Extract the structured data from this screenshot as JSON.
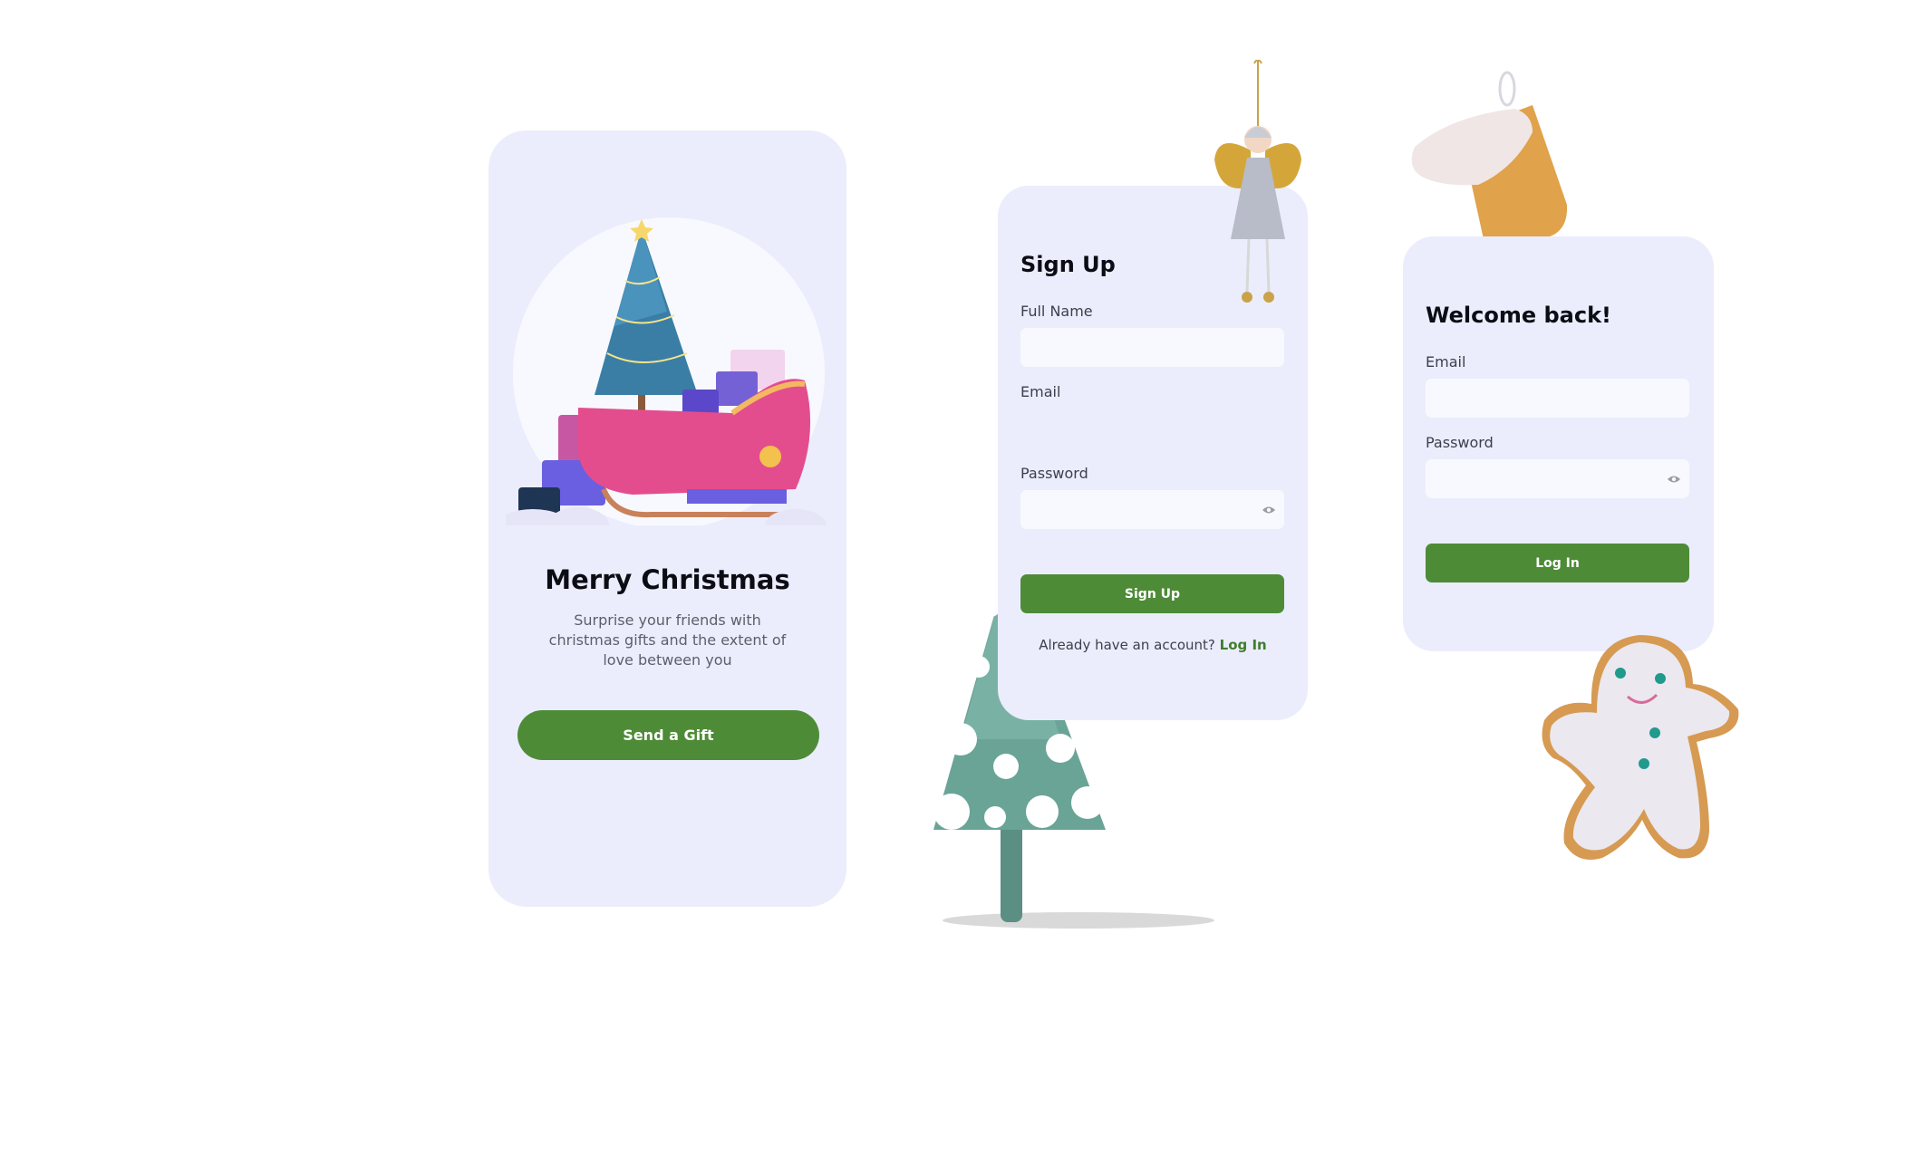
{
  "onboarding": {
    "title": "Merry Christmas",
    "subtitle": "Surprise your friends with christmas gifts and the extent of love between you",
    "cta_label": "Send a Gift"
  },
  "signup": {
    "title": "Sign Up",
    "full_name_label": "Full Name",
    "full_name_value": "",
    "email_label": "Email",
    "password_label": "Password",
    "password_value": "",
    "submit_label": "Sign Up",
    "footer_prompt": "Already have an account?",
    "footer_link": "Log In"
  },
  "login": {
    "title": "Welcome back!",
    "email_label": "Email",
    "email_value": "",
    "password_label": "Password",
    "password_value": "",
    "submit_label": "Log In"
  },
  "colors": {
    "card_bg": "#ebedfc",
    "accent_green": "#4e8b37",
    "input_bg": "#f8f9fe"
  },
  "decorations": [
    "sleigh-illustration",
    "angel-ornament",
    "stocking-ornament",
    "snowy-tree",
    "gingerbread-man"
  ]
}
